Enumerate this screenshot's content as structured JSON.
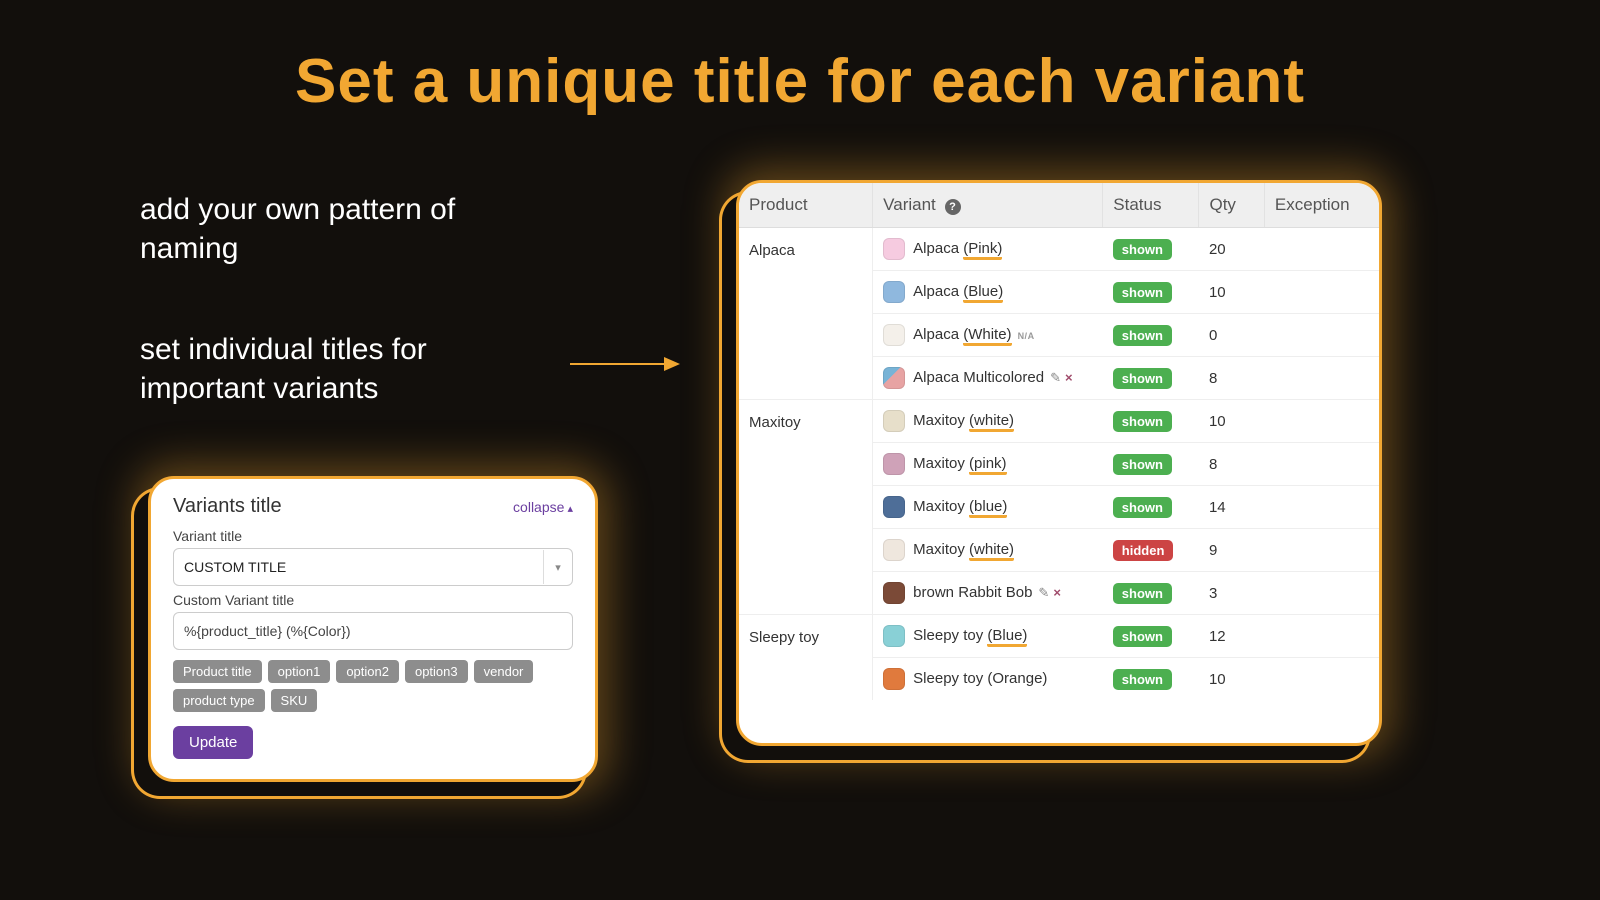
{
  "headline": "Set a unique title for each variant",
  "sub1": "add your own pattern of naming",
  "sub2": "set individual titles for important variants",
  "left_card": {
    "title": "Variants title",
    "collapse": "collapse",
    "variant_title_label": "Variant title",
    "select_value": "CUSTOM TITLE",
    "custom_label": "Custom Variant title",
    "input_value": "%{product_title} (%{Color})",
    "chips": [
      "Product title",
      "option1",
      "option2",
      "option3",
      "vendor",
      "product type",
      "SKU"
    ],
    "update": "Update"
  },
  "table": {
    "headers": {
      "product": "Product",
      "variant": "Variant",
      "status": "Status",
      "qty": "Qty",
      "exception": "Exception"
    },
    "products": [
      {
        "name": "Alpaca",
        "rows": [
          {
            "variant_pre": "Alpaca ",
            "variant_hl": "(Pink)",
            "variant_post": "",
            "swatch": "#f6cbe0",
            "status": "shown",
            "qty": "20",
            "na": false,
            "edit": false
          },
          {
            "variant_pre": "Alpaca ",
            "variant_hl": "(Blue)",
            "variant_post": "",
            "swatch": "#8fb8de",
            "status": "shown",
            "qty": "10",
            "na": false,
            "edit": false
          },
          {
            "variant_pre": "Alpaca ",
            "variant_hl": "(White)",
            "variant_post": "",
            "swatch": "#f4f0ea",
            "status": "shown",
            "qty": "0",
            "na": true,
            "edit": false
          },
          {
            "variant_pre": "",
            "variant_hl": "",
            "variant_post": "Alpaca Multicolored",
            "swatch": "linear-gradient(135deg,#78b3d6 40%,#e7a3a3 40%)",
            "status": "shown",
            "qty": "8",
            "na": false,
            "edit": true
          }
        ]
      },
      {
        "name": "Maxitoy",
        "rows": [
          {
            "variant_pre": "Maxitoy ",
            "variant_hl": "(white)",
            "variant_post": "",
            "swatch": "#e7dfca",
            "status": "shown",
            "qty": "10",
            "na": false,
            "edit": false
          },
          {
            "variant_pre": "Maxitoy ",
            "variant_hl": "(pink)",
            "variant_post": "",
            "swatch": "#cfa2b8",
            "status": "shown",
            "qty": "8",
            "na": false,
            "edit": false
          },
          {
            "variant_pre": "Maxitoy ",
            "variant_hl": "(blue)",
            "variant_post": "",
            "swatch": "#4e6e98",
            "status": "shown",
            "qty": "14",
            "na": false,
            "edit": false
          },
          {
            "variant_pre": "Maxitoy ",
            "variant_hl": "(white)",
            "variant_post": "",
            "swatch": "#efe7de",
            "status": "hidden",
            "qty": "9",
            "na": false,
            "edit": false
          },
          {
            "variant_pre": "",
            "variant_hl": "",
            "variant_post": "brown Rabbit Bob",
            "swatch": "#7b4a37",
            "status": "shown",
            "qty": "3",
            "na": false,
            "edit": true
          }
        ]
      },
      {
        "name": "Sleepy toy",
        "rows": [
          {
            "variant_pre": "Sleepy toy ",
            "variant_hl": "(Blue)",
            "variant_post": "",
            "swatch": "#89d0d6",
            "status": "shown",
            "qty": "12",
            "na": false,
            "edit": false
          },
          {
            "variant_pre": "Sleepy toy (Orange)",
            "variant_hl": "",
            "variant_post": "",
            "swatch": "#e07a3d",
            "status": "shown",
            "qty": "10",
            "na": false,
            "edit": false
          }
        ]
      }
    ]
  }
}
